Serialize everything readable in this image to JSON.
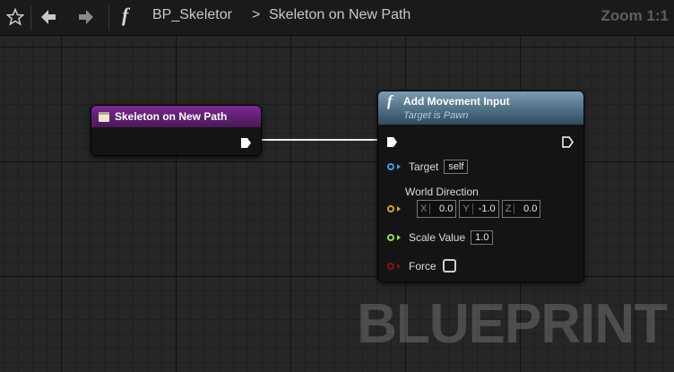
{
  "toolbar": {
    "function_glyph": "f",
    "blueprint_name": "BP_Skeletor",
    "separator": ">",
    "graph_name": "Skeleton on New Path",
    "zoom": "Zoom 1:1"
  },
  "event_node": {
    "title": "Skeleton on New Path",
    "header_color": "#5a1f6a"
  },
  "function_node": {
    "function_glyph": "f",
    "title": "Add Movement Input",
    "subtitle": "Target is Pawn",
    "header_color": "#4a6a80",
    "pins": {
      "target": {
        "label": "Target",
        "value": "self",
        "color": "#3aa0e0"
      },
      "world_direction": {
        "label": "World Direction",
        "color": "#e0a020",
        "components": [
          {
            "axis": "X",
            "value": "0.0"
          },
          {
            "axis": "Y",
            "value": "-1.0"
          },
          {
            "axis": "Z",
            "value": "0.0"
          }
        ]
      },
      "scale_value": {
        "label": "Scale Value",
        "value": "1.0",
        "color": "#90e040"
      },
      "force": {
        "label": "Force",
        "checked": false,
        "color": "#8a1010"
      }
    }
  },
  "watermark": "BLUEPRINT"
}
